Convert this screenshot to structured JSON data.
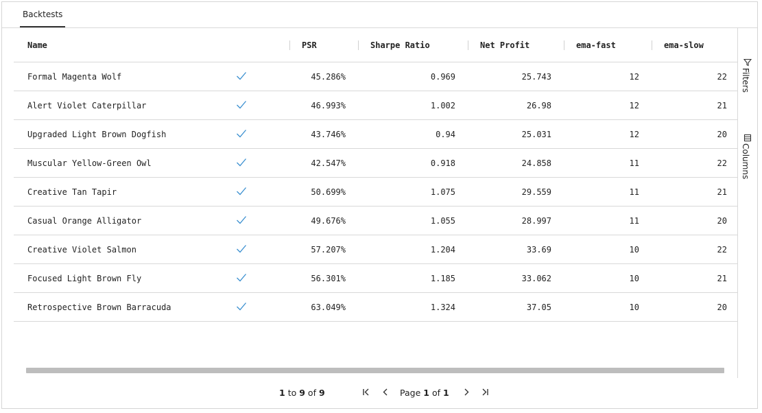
{
  "tabs": [
    {
      "label": "Backtests"
    }
  ],
  "columns": {
    "name": "Name",
    "psr": "PSR",
    "sharpe": "Sharpe Ratio",
    "net_profit": "Net Profit",
    "ema_fast": "ema-fast",
    "ema_slow": "ema-slow"
  },
  "rows": [
    {
      "name": "Formal Magenta Wolf",
      "status": "check-icon",
      "psr": "45.286%",
      "sharpe": "0.969",
      "net_profit": "25.743",
      "ema_fast": "12",
      "ema_slow": "22"
    },
    {
      "name": "Alert Violet Caterpillar",
      "status": "check-icon",
      "psr": "46.993%",
      "sharpe": "1.002",
      "net_profit": "26.98",
      "ema_fast": "12",
      "ema_slow": "21"
    },
    {
      "name": "Upgraded Light Brown Dogfish",
      "status": "check-icon",
      "psr": "43.746%",
      "sharpe": "0.94",
      "net_profit": "25.031",
      "ema_fast": "12",
      "ema_slow": "20"
    },
    {
      "name": "Muscular Yellow-Green Owl",
      "status": "check-icon",
      "psr": "42.547%",
      "sharpe": "0.918",
      "net_profit": "24.858",
      "ema_fast": "11",
      "ema_slow": "22"
    },
    {
      "name": "Creative Tan Tapir",
      "status": "check-icon",
      "psr": "50.699%",
      "sharpe": "1.075",
      "net_profit": "29.559",
      "ema_fast": "11",
      "ema_slow": "21"
    },
    {
      "name": "Casual Orange Alligator",
      "status": "check-icon",
      "psr": "49.676%",
      "sharpe": "1.055",
      "net_profit": "28.997",
      "ema_fast": "11",
      "ema_slow": "20"
    },
    {
      "name": "Creative Violet Salmon",
      "status": "check-icon",
      "psr": "57.207%",
      "sharpe": "1.204",
      "net_profit": "33.69",
      "ema_fast": "10",
      "ema_slow": "22"
    },
    {
      "name": "Focused Light Brown Fly",
      "status": "check-icon",
      "psr": "56.301%",
      "sharpe": "1.185",
      "net_profit": "33.062",
      "ema_fast": "10",
      "ema_slow": "21"
    },
    {
      "name": "Retrospective Brown Barracuda",
      "status": "check-icon",
      "psr": "63.049%",
      "sharpe": "1.324",
      "net_profit": "37.05",
      "ema_fast": "10",
      "ema_slow": "20"
    }
  ],
  "side_panel": {
    "filters": "Filters",
    "columns": "Columns"
  },
  "pagination": {
    "from": "1",
    "to_word": "to",
    "to": "9",
    "of_word": "of",
    "total": "9",
    "page_word": "Page",
    "page": "1",
    "of_word2": "of",
    "pages": "1"
  },
  "colors": {
    "check": "#3a8fd0",
    "border": "#d8d8d8",
    "scrollbar": "#bdbdbd"
  }
}
